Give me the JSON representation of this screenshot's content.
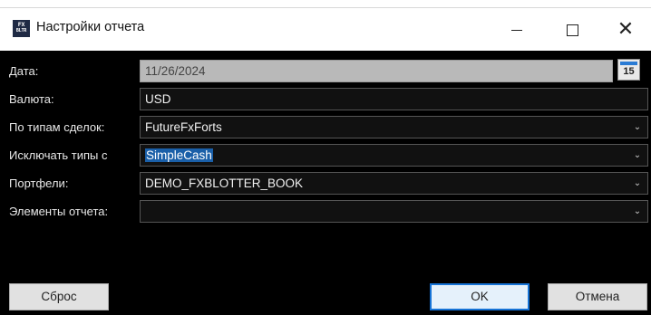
{
  "window": {
    "title": "Настройки отчета",
    "icon_text_top": "FX",
    "icon_text_bottom": "BLTR",
    "controls": {
      "minimize": "minimize-icon",
      "maximize": "maximize-icon",
      "close": "✕"
    }
  },
  "form": {
    "date": {
      "label": "Дата:",
      "value": "11/26/2024",
      "calendar_day": "15"
    },
    "currency": {
      "label": "Валюта:",
      "value": "USD"
    },
    "deal_types": {
      "label": "По типам сделок:",
      "value": "FutureFxForts"
    },
    "exclude_types": {
      "label": "Исключать типы с",
      "value": "SimpleCash"
    },
    "portfolios": {
      "label": "Портфели:",
      "value": "DEMO_FXBLOTTER_BOOK"
    },
    "report_elements": {
      "label": "Элементы отчета:",
      "value": ""
    }
  },
  "buttons": {
    "reset": "Сброс",
    "ok": "OK",
    "cancel": "Отмена"
  },
  "colors": {
    "client_bg": "#000000",
    "accent": "#1673d6",
    "selection": "#1a5fa8"
  }
}
